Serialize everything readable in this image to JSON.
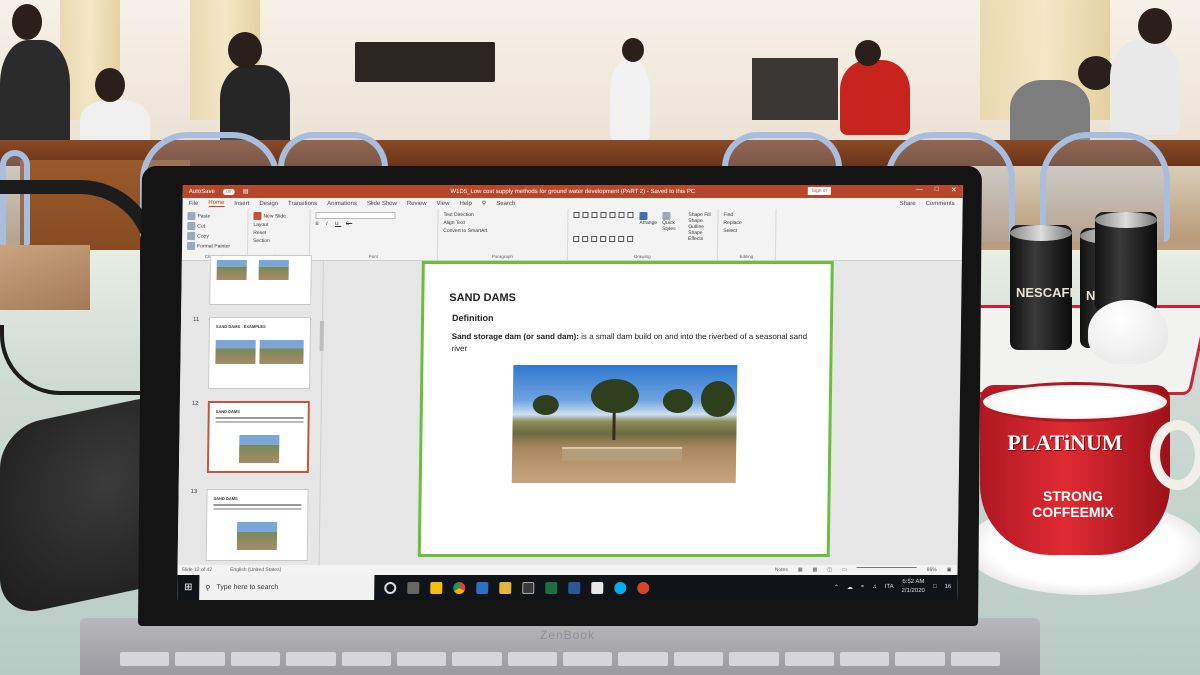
{
  "powerpoint": {
    "autosave_label": "AutoSave",
    "autosave_state": "Off",
    "title": "W1D5_Low cost supply methods for ground water development (PART 2)  -  Saved to this PC",
    "sign_in": "Sign in",
    "tabs": [
      "File",
      "Home",
      "Insert",
      "Design",
      "Transitions",
      "Animations",
      "Slide Show",
      "Review",
      "View",
      "Help",
      "Search"
    ],
    "share": "Share",
    "comments": "Comments",
    "ribbon": {
      "clipboard": {
        "paste": "Paste",
        "cut": "Cut",
        "copy": "Copy",
        "format_painter": "Format Painter",
        "label": "Clipboard"
      },
      "slides": {
        "new_slide": "New Slide",
        "layout": "Layout",
        "reset": "Reset",
        "section": "Section",
        "label": "Slides"
      },
      "font_label": "Font",
      "paragraph": {
        "text_direction": "Text Direction",
        "align_text": "Align Text",
        "convert_smartart": "Convert to SmartArt",
        "label": "Paragraph"
      },
      "drawing": {
        "arrange": "Arrange",
        "quick_styles": "Quick Styles",
        "shape_fill": "Shape Fill",
        "shape_outline": "Shape Outline",
        "shape_effects": "Shape Effects",
        "label": "Drawing"
      },
      "editing": {
        "find": "Find",
        "replace": "Replace",
        "select": "Select",
        "label": "Editing"
      }
    },
    "thumbnails": [
      {
        "number": "",
        "title": ""
      },
      {
        "number": "11",
        "title": "SAND DAMS - EXAMPLES"
      },
      {
        "number": "12",
        "title": "SAND DAMS"
      },
      {
        "number": "13",
        "title": "SAND DAMS"
      }
    ],
    "slide": {
      "title": "SAND DAMS",
      "subtitle": "Definition",
      "term": "Sand storage dam (or sand dam):",
      "definition": " is a small dam build on and into the riverbed of a seasonal sand river"
    },
    "status": {
      "slide_count": "Slide 12 of 42",
      "language": "English (United States)",
      "notes": "Notes",
      "zoom": "86%"
    }
  },
  "taskbar": {
    "search_placeholder": "Type here to search",
    "language": "ITA",
    "time": "6:52 AM",
    "date": "2/1/2020",
    "notifications": "16"
  },
  "scene": {
    "cup_brand": "PLATiNUM",
    "cup_sub_1": "STRONG",
    "cup_sub_2": "COFFEEMIX",
    "can_label": "NESCAFE",
    "laptop_brand": "ZenBook"
  }
}
